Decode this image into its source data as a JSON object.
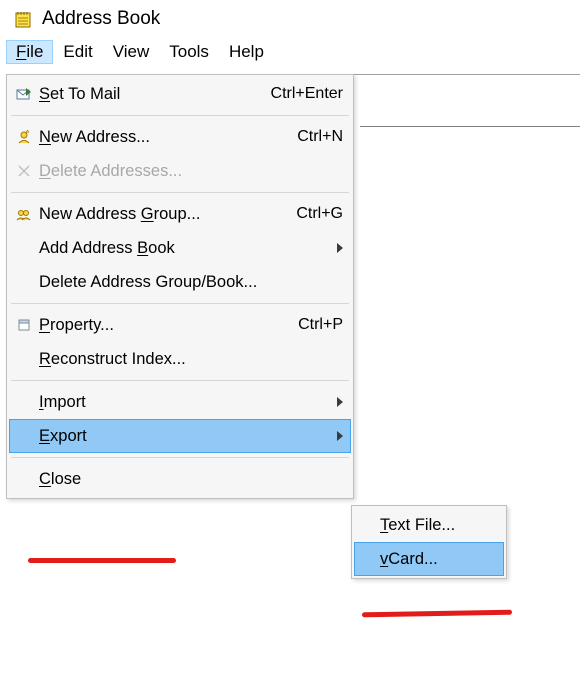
{
  "window": {
    "title": "Address Book"
  },
  "menubar": {
    "file": "File",
    "file_u": "F",
    "edit": "Edit",
    "view": "View",
    "tools": "Tools",
    "help": "Help"
  },
  "menu": {
    "set_to_mail": "Set To Mail",
    "set_to_mail_u": "S",
    "set_to_mail_sc": "Ctrl+Enter",
    "new_address": "New Address...",
    "new_address_u": "N",
    "new_address_sc": "Ctrl+N",
    "delete_addresses": "Delete Addresses...",
    "delete_addresses_u": "D",
    "new_group": "New Address Group...",
    "new_group_u": "G",
    "new_group_sc": "Ctrl+G",
    "add_book": "Add Address Book",
    "add_book_u": "B",
    "delete_group": "Delete Address Group/Book...",
    "property": "Property...",
    "property_u": "P",
    "property_sc": "Ctrl+P",
    "reconstruct": "Reconstruct Index...",
    "reconstruct_u": "R",
    "import": "Import",
    "import_u": "I",
    "export": "Export",
    "export_u": "E",
    "close": "Close",
    "close_u": "C"
  },
  "submenu": {
    "text_file": "Text File...",
    "text_file_u": "T",
    "vcard": "vCard...",
    "vcard_u": "v"
  }
}
